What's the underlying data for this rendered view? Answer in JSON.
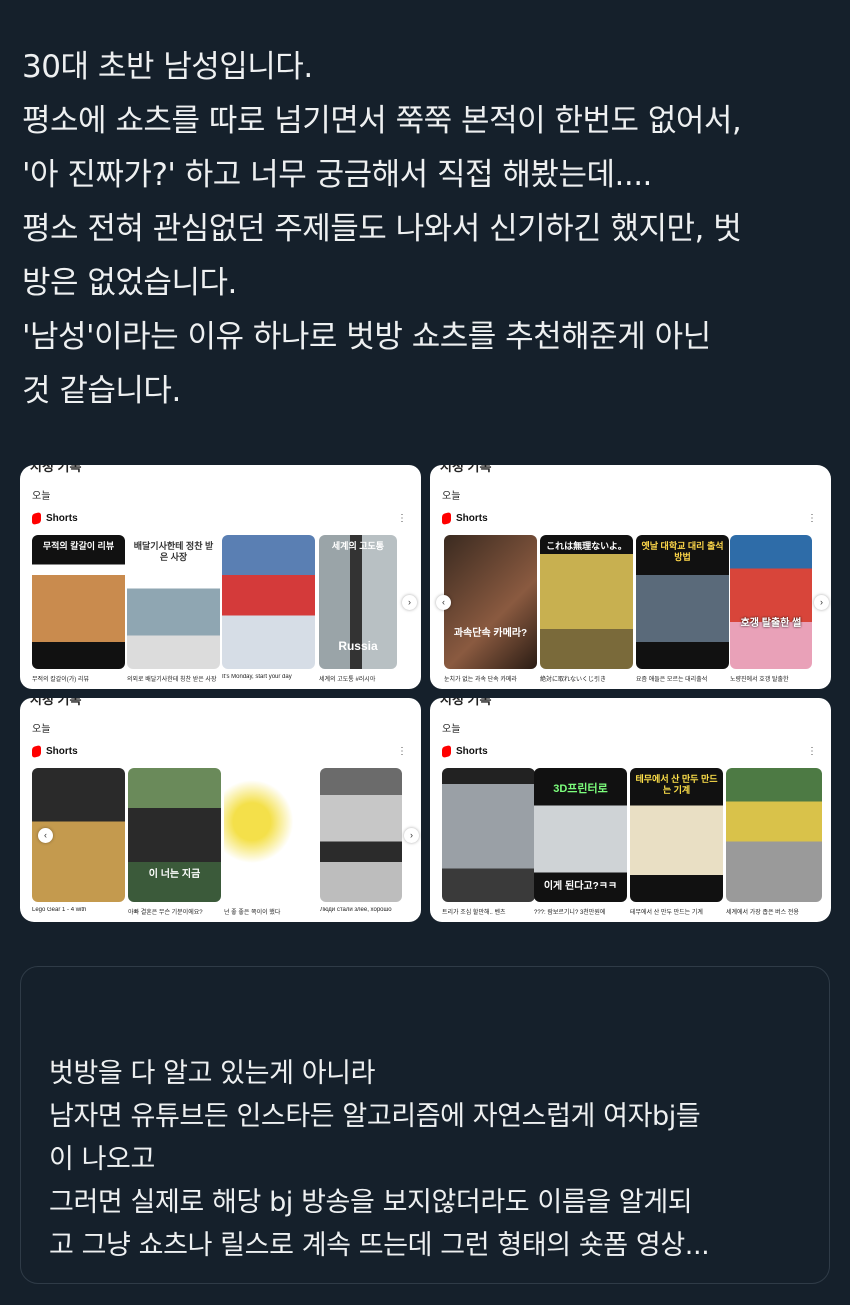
{
  "post": {
    "lines": [
      "30대 초반 남성입니다.",
      "평소에 쇼츠를 따로 넘기면서 쭉쭉 본적이 한번도 없어서,",
      "'아 진짜가?' 하고 너무 궁금해서 직접 해봤는데....",
      "평소 전혀 관심없던 주제들도 나와서 신기하긴 했지만, 벗",
      "방은 없었습니다.",
      "'남성'이라는 이유 하나로 벗방 쇼츠를 추천해준게 아닌",
      "것 같습니다."
    ]
  },
  "screenshots": [
    {
      "header_cut": "시청 기록",
      "section": "오늘",
      "shelf": "Shorts",
      "thumb_labels": [
        "무적의 칼갈이 리뷰",
        "배달기사한테 정찬 받은 사장",
        "",
        "세계의 고도통"
      ],
      "thumb_captions": [
        "",
        "",
        "",
        "Russia"
      ],
      "titles": [
        "무적의 칼갈이(가) 리뷰",
        "의외로 배달기사한테 칭찬 받은 사장",
        "It's Monday, start your day",
        "세계의 고도통 #러시아"
      ]
    },
    {
      "header_cut": "시청 기록",
      "section": "오늘",
      "shelf": "Shorts",
      "thumb_labels": [
        "",
        "これは無理ないよ。",
        "옛날 대학교 대리 출석 방법",
        ""
      ],
      "thumb_captions": [
        "과속단속 카메라?",
        "",
        "",
        "호갱 탈출한 썰"
      ],
      "titles": [
        "눈치가 없는 과속 단속 카메라",
        "絶対に取れないくじ引き",
        "요즘 애들은 모르는 대리출석",
        "노량진에서 호갱 탈출한"
      ]
    },
    {
      "header_cut": "시청 기록",
      "section": "오늘",
      "shelf": "Shorts",
      "thumb_labels": [
        "",
        "",
        "",
        ""
      ],
      "thumb_captions": [
        "",
        "이 너는 지금",
        "",
        ""
      ],
      "titles": [
        "Lego Gear 1 - 4 with",
        "아빠 결혼은 무슨 기분이에요?",
        "넌 좋 좋은 쪽이이 했다",
        "Люди стали злее, хорошо"
      ]
    },
    {
      "header_cut": "시청 기록",
      "section": "오늘",
      "shelf": "Shorts",
      "thumb_labels": [
        "",
        "3D프린터로",
        "테무에서 산 만두 만드는 기계",
        ""
      ],
      "thumb_captions": [
        "",
        "이게 된다고?ㅋㅋ",
        "",
        ""
      ],
      "titles": [
        "트리가 조심 할만해.. 벤츠",
        "???: 람보르기니? 3천만원에",
        "테무에서 산 만두 만드는 기계",
        "세계에서 가장 좁은 버스 전용"
      ]
    }
  ],
  "quote": {
    "lines": [
      "벗방을 다 알고 있는게 아니라",
      "남자면 유튜브든 인스타든 알고리즘에 자연스럽게 여자bj들",
      "이 나오고",
      "그러면 실제로 해당 bj 방송을 보지않더라도 이름을 알게되",
      "고 그냥 쇼츠나 릴스로 계속 뜨는데 그런 형태의 숏폼 영상..."
    ]
  }
}
